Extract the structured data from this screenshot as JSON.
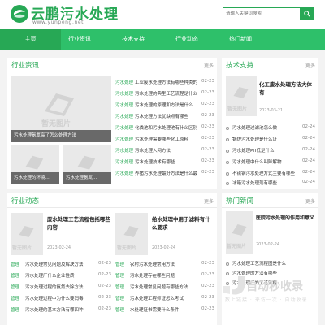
{
  "header": {
    "logo_text": "云鹏污水处理",
    "logo_url": "www.yunpeng.net",
    "search_placeholder": "请输入关键词搜索"
  },
  "colors": {
    "brand": "#27a855",
    "nav": "#2ec06a"
  },
  "nav": [
    {
      "label": "主页"
    },
    {
      "label": "行业资讯"
    },
    {
      "label": "技术支持"
    },
    {
      "label": "行业动态"
    },
    {
      "label": "热门新闻"
    }
  ],
  "industry_news": {
    "title": "行业资讯",
    "more": "更多",
    "thumb_main_caption": "污水处理氨氮高了怎么处理方法",
    "thumb_small_1_caption": "污水处理的环境...",
    "thumb_small_2_caption": "污水处理氨氮...",
    "watermark": "暂无图片",
    "items": [
      {
        "tag": "污水处理",
        "text": "工业废水处理方法有哪些种类的",
        "date": "02-23"
      },
      {
        "tag": "污水处理",
        "text": "污水处理的典型工艺流程是什么",
        "date": "02-23"
      },
      {
        "tag": "污水处理",
        "text": "污水处理的原理和方法是什么",
        "date": "02-23"
      },
      {
        "tag": "污水处理",
        "text": "污水处理方法优缺点有哪些",
        "date": "02-23"
      },
      {
        "tag": "污水处理",
        "text": "化粪池和污水处理池有什么区别",
        "date": "02-23"
      },
      {
        "tag": "污水处理",
        "text": "污水处理需要哪些化工原料",
        "date": "02-23"
      },
      {
        "tag": "污水处理",
        "text": "污水处理入网方法",
        "date": "02-23"
      },
      {
        "tag": "污水处理",
        "text": "污水处理技术有哪些",
        "date": "02-23"
      },
      {
        "tag": "污水处理",
        "text": "养猪污水处理最好方法是什么最",
        "date": "02-23"
      }
    ]
  },
  "tech_support": {
    "title": "技术支持",
    "more": "更多",
    "feat_title": "化工废水处理方法大体有",
    "feat_date": "2023-03-21",
    "watermark": "暂无图片",
    "items": [
      {
        "text": "污水处理过滤池怎么做",
        "date": "02-24"
      },
      {
        "text": "锅炉污水处理是什么证",
        "date": "02-24"
      },
      {
        "text": "污水处理PH低是什么",
        "date": "02-24"
      },
      {
        "text": "污水处理中什么叫降解物",
        "date": "02-24"
      },
      {
        "text": "不锈钢污水处理方式主要有哪些",
        "date": "02-24"
      },
      {
        "text": "冰箱污水处理剂有哪些",
        "date": "02-24"
      }
    ]
  },
  "industry_dynamic": {
    "title": "行业动态",
    "more": "更多",
    "watermark": "暂无图片",
    "feat_1_title": "废水处理工艺流程包括哪些内容",
    "feat_1_date": "2023-02-24",
    "feat_2_title": "给水处理中用于滤料有什么要求",
    "feat_2_date": "2023-02-24",
    "items_left": [
      {
        "tag": "管理",
        "text": "污水处理常见问题及解决方法",
        "date": "02-23"
      },
      {
        "tag": "管理",
        "text": "污水处理厂什么企业性质",
        "date": "02-23"
      },
      {
        "tag": "管理",
        "text": "污水处理过程的氨氮去除方法",
        "date": "02-23"
      },
      {
        "tag": "管理",
        "text": "污水处理过程中为什么要消毒",
        "date": "02-23"
      },
      {
        "tag": "管理",
        "text": "污水处理的基本方法有哪四种",
        "date": "02-23"
      }
    ],
    "items_right": [
      {
        "tag": "管理",
        "text": "农村污水处理常用方法",
        "date": "02-23"
      },
      {
        "tag": "管理",
        "text": "污水处理存在哪些问题",
        "date": "02-23"
      },
      {
        "tag": "管理",
        "text": "污水处理常见问题有哪些方法",
        "date": "02-23"
      },
      {
        "tag": "管理",
        "text": "污水处理工程师证怎么考试",
        "date": "02-23"
      },
      {
        "tag": "管理",
        "text": "水处理证书需要什么条件",
        "date": "02-23"
      }
    ]
  },
  "hot_news": {
    "title": "热门新闻",
    "more": "更多",
    "feat_title": "医院污水处理的作用和意义",
    "feat_date": "2023-02-24",
    "watermark": "暂无图片",
    "items": [
      {
        "text": "污水处理工艺流程图是什么",
        "date": ""
      },
      {
        "text": "污水处理的方法有哪些",
        "date": ""
      },
      {
        "text": "污水处理厂的工艺流程",
        "date": ""
      }
    ],
    "ad_text": "自动秒收录",
    "ad_sub": "数上链接 · 来访一次 · 自动收录"
  }
}
